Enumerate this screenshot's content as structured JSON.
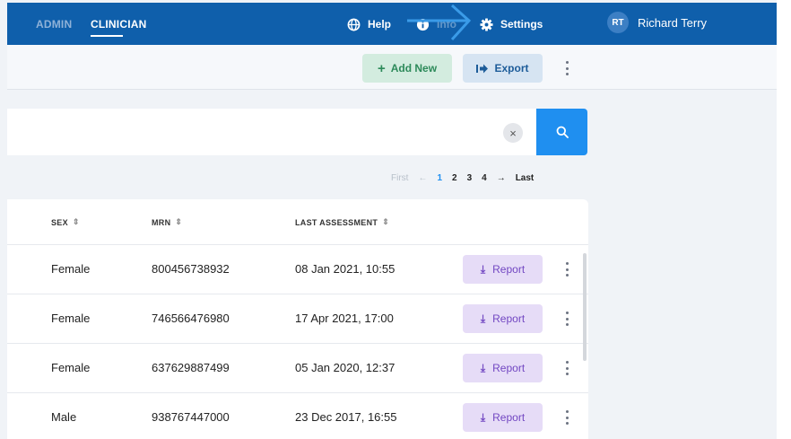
{
  "topbar": {
    "roles": {
      "admin": "ADMIN",
      "clinician": "CLINICIAN"
    },
    "help_label": "Help",
    "info_label": "Info",
    "settings_label": "Settings",
    "user": {
      "initials": "RT",
      "name": "Richard Terry"
    },
    "colors": {
      "bar": "#0f5fab",
      "avatar": "#3c7fc4"
    }
  },
  "actions": {
    "add_label": "Add New",
    "export_label": "Export"
  },
  "search": {
    "value": "",
    "clear_glyph": "×"
  },
  "pagination": {
    "first": "First",
    "prev": "←",
    "pages": [
      "1",
      "2",
      "3",
      "4"
    ],
    "current": "1",
    "next": "→",
    "last": "Last"
  },
  "table": {
    "columns": {
      "sex": "SEX",
      "mrn": "MRN",
      "last_assessment": "LAST ASSESSMENT"
    },
    "rows": [
      {
        "sex": "Female",
        "mrn": "800456738932",
        "last_assessment": "08 Jan 2021, 10:55",
        "action": "Report"
      },
      {
        "sex": "Female",
        "mrn": "746566476980",
        "last_assessment": "17 Apr 2021, 17:00",
        "action": "Report"
      },
      {
        "sex": "Female",
        "mrn": "637629887499",
        "last_assessment": "05 Jan 2020, 12:37",
        "action": "Report"
      },
      {
        "sex": "Male",
        "mrn": "938767447000",
        "last_assessment": "23 Dec 2017, 16:55",
        "action": "Report"
      }
    ]
  },
  "icons": {
    "help": "globe-icon",
    "info": "info-icon",
    "settings": "gear-icon",
    "add": "plus-icon",
    "export": "export-icon",
    "search": "search-icon",
    "report": "download-icon",
    "sort": "sort-icon",
    "more": "kebab-menu-icon"
  }
}
